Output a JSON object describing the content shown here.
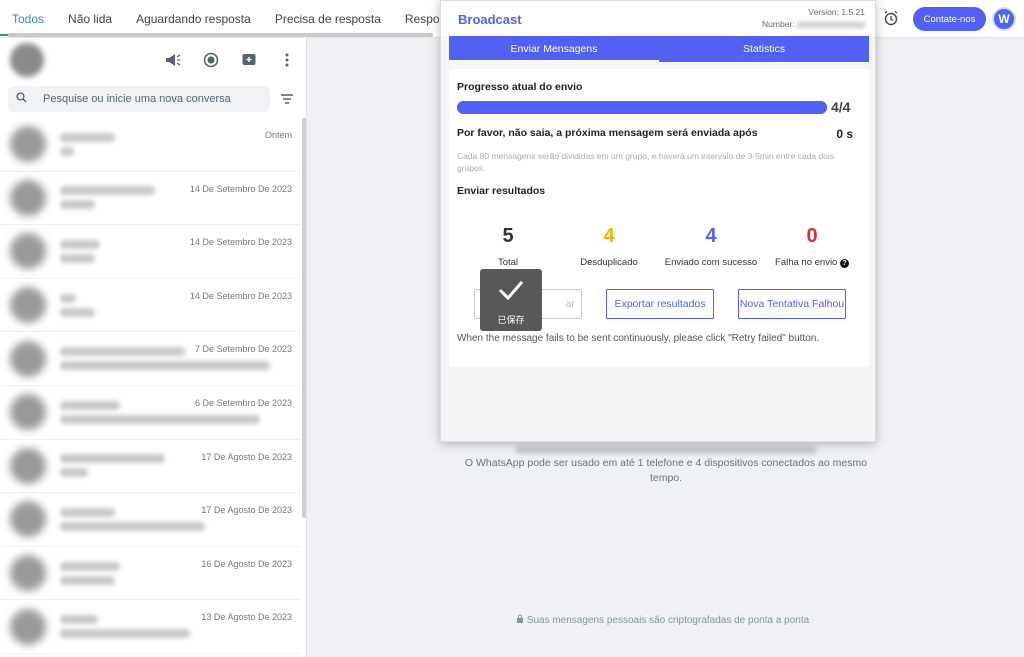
{
  "filter_tabs": [
    {
      "label": "Todos",
      "active": true
    },
    {
      "label": "Não lida"
    },
    {
      "label": "Aguardando resposta"
    },
    {
      "label": "Precisa de resposta"
    },
    {
      "label": "Resposta auto"
    }
  ],
  "search": {
    "placeholder": "Pesquise ou inicie uma nova conversa"
  },
  "chats": [
    {
      "date": "Ontem"
    },
    {
      "date": "14 De Setembro De 2023"
    },
    {
      "date": "14 De Setembro De 2023"
    },
    {
      "date": "14 De Setembro De 2023"
    },
    {
      "date": "7 De Setembro De 2023"
    },
    {
      "date": "6 De Setembro De 2023"
    },
    {
      "date": "17 De Agosto De 2023"
    },
    {
      "date": "17 De Agosto De 2023"
    },
    {
      "date": "16 De Agosto De 2023"
    },
    {
      "date": "13 De Agosto De 2023"
    }
  ],
  "main": {
    "devices_text": "O WhatsApp pode ser usado em até 1 telefone e 4 dispositivos conectados ao mesmo tempo.",
    "footer": "Suas mensagens pessoais são criptografadas de ponta a ponta"
  },
  "topbar": {
    "contact_label": "Contate-nos",
    "logo_letter": "W"
  },
  "broadcast": {
    "title": "Broadcast",
    "version": "Version: 1.5.21",
    "number_label": "Number:",
    "tabs": [
      {
        "label": "Enviar Mensagens",
        "active": true
      },
      {
        "label": "Statistics"
      }
    ],
    "progress_label": "Progresso atual do envio",
    "progress": {
      "sent": 4,
      "total": 4,
      "fraction": 1.0,
      "text": "4/4"
    },
    "wait_label": "Por favor, não saia, a próxima mensagem será enviada após",
    "wait_value": "0 s",
    "hint": "Cada 80 mensagens serão divididas em um grupo, e haverá um intervalo de 3-5min entre cada dois grupos.",
    "results_label": "Enviar resultados",
    "stats": [
      {
        "value": "5",
        "label": "Total",
        "color": "#333333"
      },
      {
        "value": "4",
        "label": "Desduplicado",
        "color": "#f5b400"
      },
      {
        "value": "4",
        "label": "Enviado com sucesso",
        "color": "#5161f5"
      },
      {
        "value": "0",
        "label": "Falha no envio",
        "color": "#d32f2f"
      }
    ],
    "buttons": {
      "hidden_partial": "ar",
      "export": "Exportar resultados",
      "retry": "Nova Tentativa Falhou"
    },
    "retry_note": "When the message fails to be sent continuously, please click \"Retry failed\" button."
  },
  "toast": {
    "text": "已保存"
  }
}
